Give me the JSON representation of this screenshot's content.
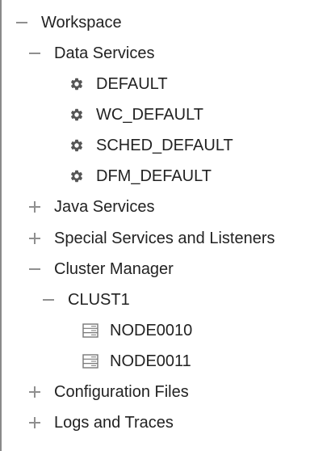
{
  "tree": {
    "workspace": {
      "label": "Workspace",
      "toggle": "collapse"
    },
    "data_services": {
      "label": "Data Services",
      "toggle": "collapse",
      "items": [
        {
          "label": "DEFAULT",
          "icon": "gear-icon"
        },
        {
          "label": "WC_DEFAULT",
          "icon": "gear-icon"
        },
        {
          "label": "SCHED_DEFAULT",
          "icon": "gear-icon"
        },
        {
          "label": "DFM_DEFAULT",
          "icon": "gear-icon"
        }
      ]
    },
    "java_services": {
      "label": "Java Services",
      "toggle": "expand"
    },
    "special_services": {
      "label": "Special Services and Listeners",
      "toggle": "expand"
    },
    "cluster_manager": {
      "label": "Cluster Manager",
      "toggle": "collapse",
      "clust1": {
        "label": "CLUST1",
        "toggle": "collapse",
        "nodes": [
          {
            "label": "NODE0010",
            "icon": "server-icon"
          },
          {
            "label": "NODE0011",
            "icon": "server-icon"
          }
        ]
      }
    },
    "configuration_files": {
      "label": "Configuration Files",
      "toggle": "expand"
    },
    "logs_and_traces": {
      "label": "Logs and Traces",
      "toggle": "expand"
    }
  },
  "colors": {
    "text": "#222222",
    "toggle": "#8f8f8f",
    "gear": "#555555",
    "server": "#777777",
    "border": "#8a8a8a"
  }
}
